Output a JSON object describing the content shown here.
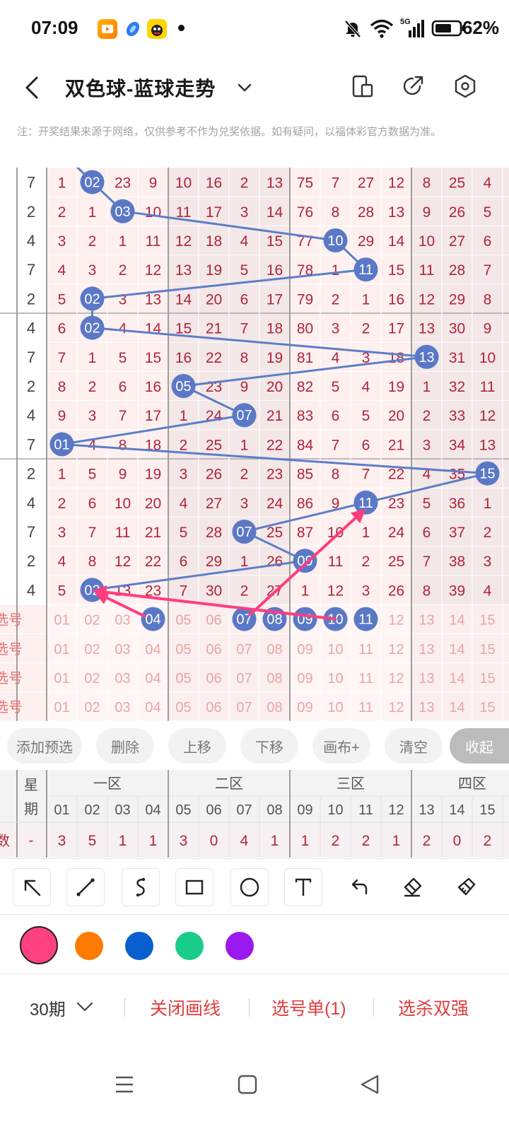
{
  "status_bar": {
    "time": "07:09",
    "network": "5G",
    "battery": "62%"
  },
  "title_bar": {
    "title": "双色球-蓝球走势"
  },
  "notice": "注：开奖结果来源于网络，仅供参考不作为兑奖依据。如有疑问，以福体彩官方数据为准。",
  "grid": {
    "week_col": [
      7,
      2,
      4,
      7,
      2,
      4,
      7,
      2,
      4,
      7,
      2,
      4,
      7,
      2,
      4
    ],
    "omission_rows": [
      [
        1,
        2,
        23,
        9,
        10,
        16,
        2,
        13,
        75,
        7,
        27,
        12,
        8,
        25,
        4
      ],
      [
        2,
        1,
        3,
        10,
        11,
        17,
        3,
        14,
        76,
        8,
        28,
        13,
        9,
        26,
        5
      ],
      [
        3,
        2,
        1,
        11,
        12,
        18,
        4,
        15,
        77,
        10,
        29,
        14,
        10,
        27,
        6
      ],
      [
        4,
        3,
        2,
        12,
        13,
        19,
        5,
        16,
        78,
        1,
        11,
        15,
        11,
        28,
        7
      ],
      [
        5,
        2,
        3,
        13,
        14,
        20,
        6,
        17,
        79,
        2,
        1,
        16,
        12,
        29,
        8
      ],
      [
        6,
        2,
        4,
        14,
        15,
        21,
        7,
        18,
        80,
        3,
        2,
        17,
        13,
        30,
        9
      ],
      [
        7,
        1,
        5,
        15,
        16,
        22,
        8,
        19,
        81,
        4,
        3,
        18,
        13,
        31,
        10
      ],
      [
        8,
        2,
        6,
        16,
        5,
        23,
        9,
        20,
        82,
        5,
        4,
        19,
        1,
        32,
        11
      ],
      [
        9,
        3,
        7,
        17,
        1,
        24,
        7,
        21,
        83,
        6,
        5,
        20,
        2,
        33,
        12
      ],
      [
        1,
        4,
        8,
        18,
        2,
        25,
        1,
        22,
        84,
        7,
        6,
        21,
        3,
        34,
        13
      ],
      [
        1,
        5,
        9,
        19,
        3,
        26,
        2,
        23,
        85,
        8,
        7,
        22,
        4,
        35,
        15
      ],
      [
        2,
        6,
        10,
        20,
        4,
        27,
        3,
        24,
        86,
        9,
        11,
        23,
        5,
        36,
        1
      ],
      [
        3,
        7,
        11,
        21,
        5,
        28,
        7,
        25,
        87,
        10,
        1,
        24,
        6,
        37,
        2
      ],
      [
        4,
        8,
        12,
        22,
        6,
        29,
        1,
        26,
        9,
        11,
        2,
        25,
        7,
        38,
        3
      ],
      [
        5,
        2,
        13,
        23,
        7,
        30,
        2,
        27,
        1,
        12,
        3,
        26,
        8,
        39,
        4
      ]
    ],
    "hits": [
      {
        "row": 0,
        "col": 1,
        "label": "02"
      },
      {
        "row": 1,
        "col": 2,
        "label": "03"
      },
      {
        "row": 2,
        "col": 9,
        "label": "10"
      },
      {
        "row": 3,
        "col": 10,
        "label": "11"
      },
      {
        "row": 4,
        "col": 1,
        "label": "02"
      },
      {
        "row": 5,
        "col": 1,
        "label": "02"
      },
      {
        "row": 6,
        "col": 12,
        "label": "13"
      },
      {
        "row": 7,
        "col": 4,
        "label": "05"
      },
      {
        "row": 8,
        "col": 6,
        "label": "07"
      },
      {
        "row": 9,
        "col": 0,
        "label": "01"
      },
      {
        "row": 10,
        "col": 14,
        "label": "15"
      },
      {
        "row": 11,
        "col": 10,
        "label": "11"
      },
      {
        "row": 12,
        "col": 6,
        "label": "07"
      },
      {
        "row": 13,
        "col": 8,
        "label": "09"
      },
      {
        "row": 14,
        "col": 1,
        "label": "02"
      }
    ],
    "pick_label": "选号",
    "pick_numbers": [
      "01",
      "02",
      "03",
      "04",
      "05",
      "06",
      "07",
      "08",
      "09",
      "10",
      "11",
      "12",
      "13",
      "14",
      "15"
    ],
    "selected_picks": [
      3,
      6,
      7,
      8,
      9,
      10
    ],
    "line_color": "#5b7ec8",
    "ball_color": "#5a78c6",
    "arrow_color": "#ff3d7f"
  },
  "buttons": {
    "add_preselect": "添加预选",
    "delete": "删除",
    "move_up": "上移",
    "move_down": "下移",
    "canvas_plus": "画布+",
    "clear": "清空",
    "collapse": "收起"
  },
  "stats": {
    "week_header": "星期",
    "zones": [
      "一区",
      "二区",
      "三区",
      "四区"
    ],
    "numbers": [
      "01",
      "02",
      "03",
      "04",
      "05",
      "06",
      "07",
      "08",
      "09",
      "10",
      "11",
      "12",
      "13",
      "14",
      "15"
    ],
    "row_label": "数",
    "week_value": "-",
    "values": [
      3,
      5,
      1,
      1,
      3,
      0,
      4,
      1,
      1,
      2,
      2,
      1,
      2,
      0,
      2
    ]
  },
  "tools": [
    "arrow-tool",
    "line-tool",
    "curve-tool",
    "rectangle-tool",
    "circle-tool",
    "text-tool",
    "undo-tool",
    "eraser-tool",
    "clear-tool"
  ],
  "palette": [
    "#ff4081",
    "#ff7a00",
    "#0a5fcf",
    "#19cc8a",
    "#9b19f0"
  ],
  "selected_color_index": 0,
  "bottom_bar": {
    "period": "30期",
    "close_drawing": "关闭画线",
    "pick_list": "选号单(1)",
    "kill_strong": "选杀双强"
  }
}
